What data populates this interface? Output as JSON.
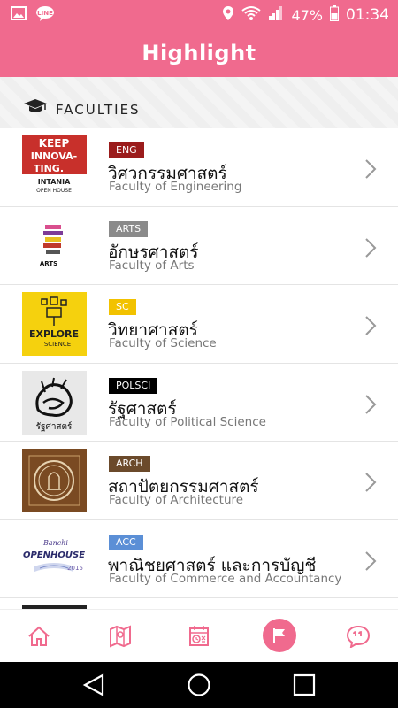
{
  "status_bar": {
    "battery": "47%",
    "time": "01:34",
    "icons": [
      "gallery-icon",
      "line-app-icon",
      "location-icon",
      "wifi-icon",
      "signal-icon",
      "battery-icon"
    ]
  },
  "app_bar": {
    "title": "Highlight"
  },
  "section": {
    "title": "FACULTIES",
    "icon": "graduation-cap-icon"
  },
  "faculties": [
    {
      "badge": "ENG",
      "badge_color": "#9b1c1c",
      "title_th": "วิศวกรรมศาสตร์",
      "title_en": "Faculty of Engineering",
      "thumb": {
        "line1": "KEEP",
        "line2": "INNOVA-",
        "line3": "TING.",
        "line4": "INTANIA",
        "line5": "OPEN HOUSE"
      }
    },
    {
      "badge": "ARTS",
      "badge_color": "#8a8a8a",
      "title_th": "อักษรศาสตร์",
      "title_en": "Faculty of Arts",
      "thumb": {
        "line1": "ARTS"
      }
    },
    {
      "badge": "SC",
      "badge_color": "#f2c200",
      "title_th": "วิทยาศาสตร์",
      "title_en": "Faculty of Science",
      "thumb": {
        "line1": "EXPLORE",
        "line2": "SCIENCE"
      }
    },
    {
      "badge": "POLSCI",
      "badge_color": "#000000",
      "title_th": "รัฐศาสตร์",
      "title_en": "Faculty of Political Science",
      "thumb": {
        "line1": "รัฐศาสตร์"
      }
    },
    {
      "badge": "ARCH",
      "badge_color": "#6b4a2b",
      "title_th": "สถาปัตยกรรมศาสตร์",
      "title_en": "Faculty of Architecture",
      "thumb": {}
    },
    {
      "badge": "ACC",
      "badge_color": "#5b8fd6",
      "title_th": "พาณิชยศาสตร์ และการบัญชี",
      "title_en": "Faculty of Commerce and Accountancy",
      "thumb": {
        "line1": "Banchi",
        "line2": "OPENHOUSE",
        "line3": "2015"
      }
    }
  ],
  "bottom_nav": {
    "items": [
      "home-icon",
      "map-icon",
      "schedule-icon",
      "highlight-flag-icon",
      "chat-icon"
    ],
    "active": "highlight-flag-icon",
    "accent": "#f06a8e"
  },
  "system_nav": [
    "back-icon",
    "home-circle-icon",
    "recents-icon"
  ]
}
